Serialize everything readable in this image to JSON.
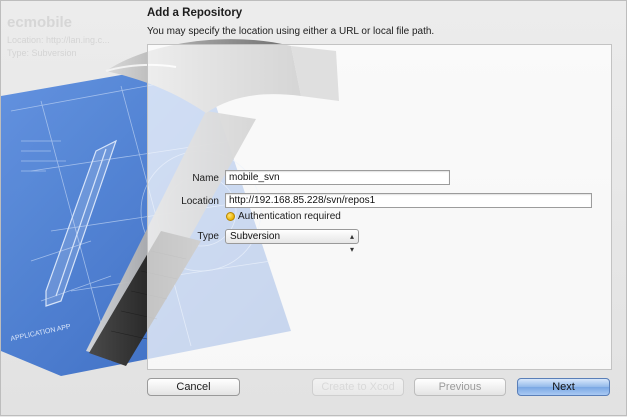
{
  "background_window": {
    "title": "ecmobile",
    "location_line": "Location: http://lan.ing.c...",
    "type_line": "Type: Subversion"
  },
  "sheet": {
    "title": "Add a Repository",
    "subtitle": "You may specify the location using either a URL or local file path."
  },
  "form": {
    "name_label": "Name",
    "name_value": "mobile_svn",
    "location_label": "Location",
    "location_value": "http://192.168.85.228/svn/repos1",
    "status_text": "Authentication required",
    "type_label": "Type",
    "type_value": "Subversion"
  },
  "hero": {
    "blueprint_label": "APPLICATION APP"
  },
  "buttons": {
    "cancel": "Cancel",
    "hidden": "Create to Xcod",
    "previous": "Previous",
    "next": "Next"
  },
  "colors": {
    "status_dot": "#eab400",
    "next_button": "#7aa7e3",
    "blueprint": "#3f74c9"
  }
}
